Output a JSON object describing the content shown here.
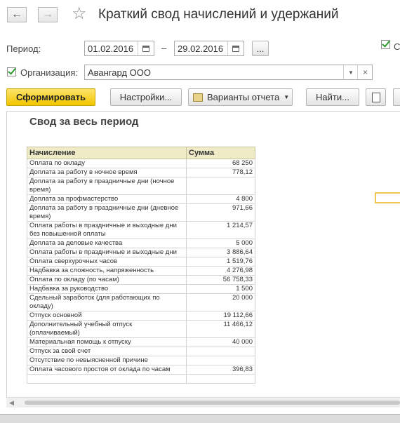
{
  "window": {
    "title": "Краткий свод начислений и удержаний",
    "icons": [
      "back-arrow-icon",
      "forward-arrow-icon",
      "star-icon"
    ]
  },
  "period": {
    "label": "Период:",
    "from": "01.02.2016",
    "dash": "–",
    "to": "29.02.2016",
    "more_label": "..."
  },
  "organization": {
    "checkbox_checked": true,
    "label": "Организация:",
    "value": "Авангард ООО",
    "clear_label": "×"
  },
  "toolbar": {
    "generate_label": "Сформировать",
    "settings_label": "Настройки...",
    "variants_label": "Варианты отчета",
    "find_label": "Найти..."
  },
  "report": {
    "title": "Свод за весь период",
    "columns": [
      "Начисление",
      "Сумма"
    ],
    "rows": [
      [
        "Оплата по окладу",
        "68 250"
      ],
      [
        "Доплата за работу в ночное время",
        "778,12"
      ],
      [
        "Доплата за работу в праздничные дни (ночное время)",
        ""
      ],
      [
        "Доплата за профмастерство",
        "4 800"
      ],
      [
        "Доплата за работу в праздничные дни (дневное время)",
        "971,66"
      ],
      [
        "Оплата работы в праздничные и выходные дни без повышенной оплаты",
        "1 214,57"
      ],
      [
        "Доплата за деловые качества",
        "5 000"
      ],
      [
        "Оплата работы в праздничные и выходные дни",
        "3 886,64"
      ],
      [
        "Оплата сверхурочных часов",
        "1 519,76"
      ],
      [
        "Надбавка за сложность, напряженность",
        "4 276,98"
      ],
      [
        "Оплата по окладу (по часам)",
        "56 758,33"
      ],
      [
        "Надбавка за руководство",
        "1 500"
      ],
      [
        "Сдельный заработок (для работающих по окладу)",
        "20 000"
      ],
      [
        "Отпуск основной",
        "19 112,66"
      ],
      [
        "Дополнительный учебный отпуск (оплачиваемый)",
        "11 466,12"
      ],
      [
        "Материальная помощь к отпуску",
        "40 000"
      ],
      [
        "Отпуск за свой счет",
        ""
      ],
      [
        "Отсутствие по невыясненной причине",
        ""
      ],
      [
        "Оплата часового простоя от оклада по часам",
        "396,83"
      ],
      [
        "",
        ""
      ]
    ]
  }
}
